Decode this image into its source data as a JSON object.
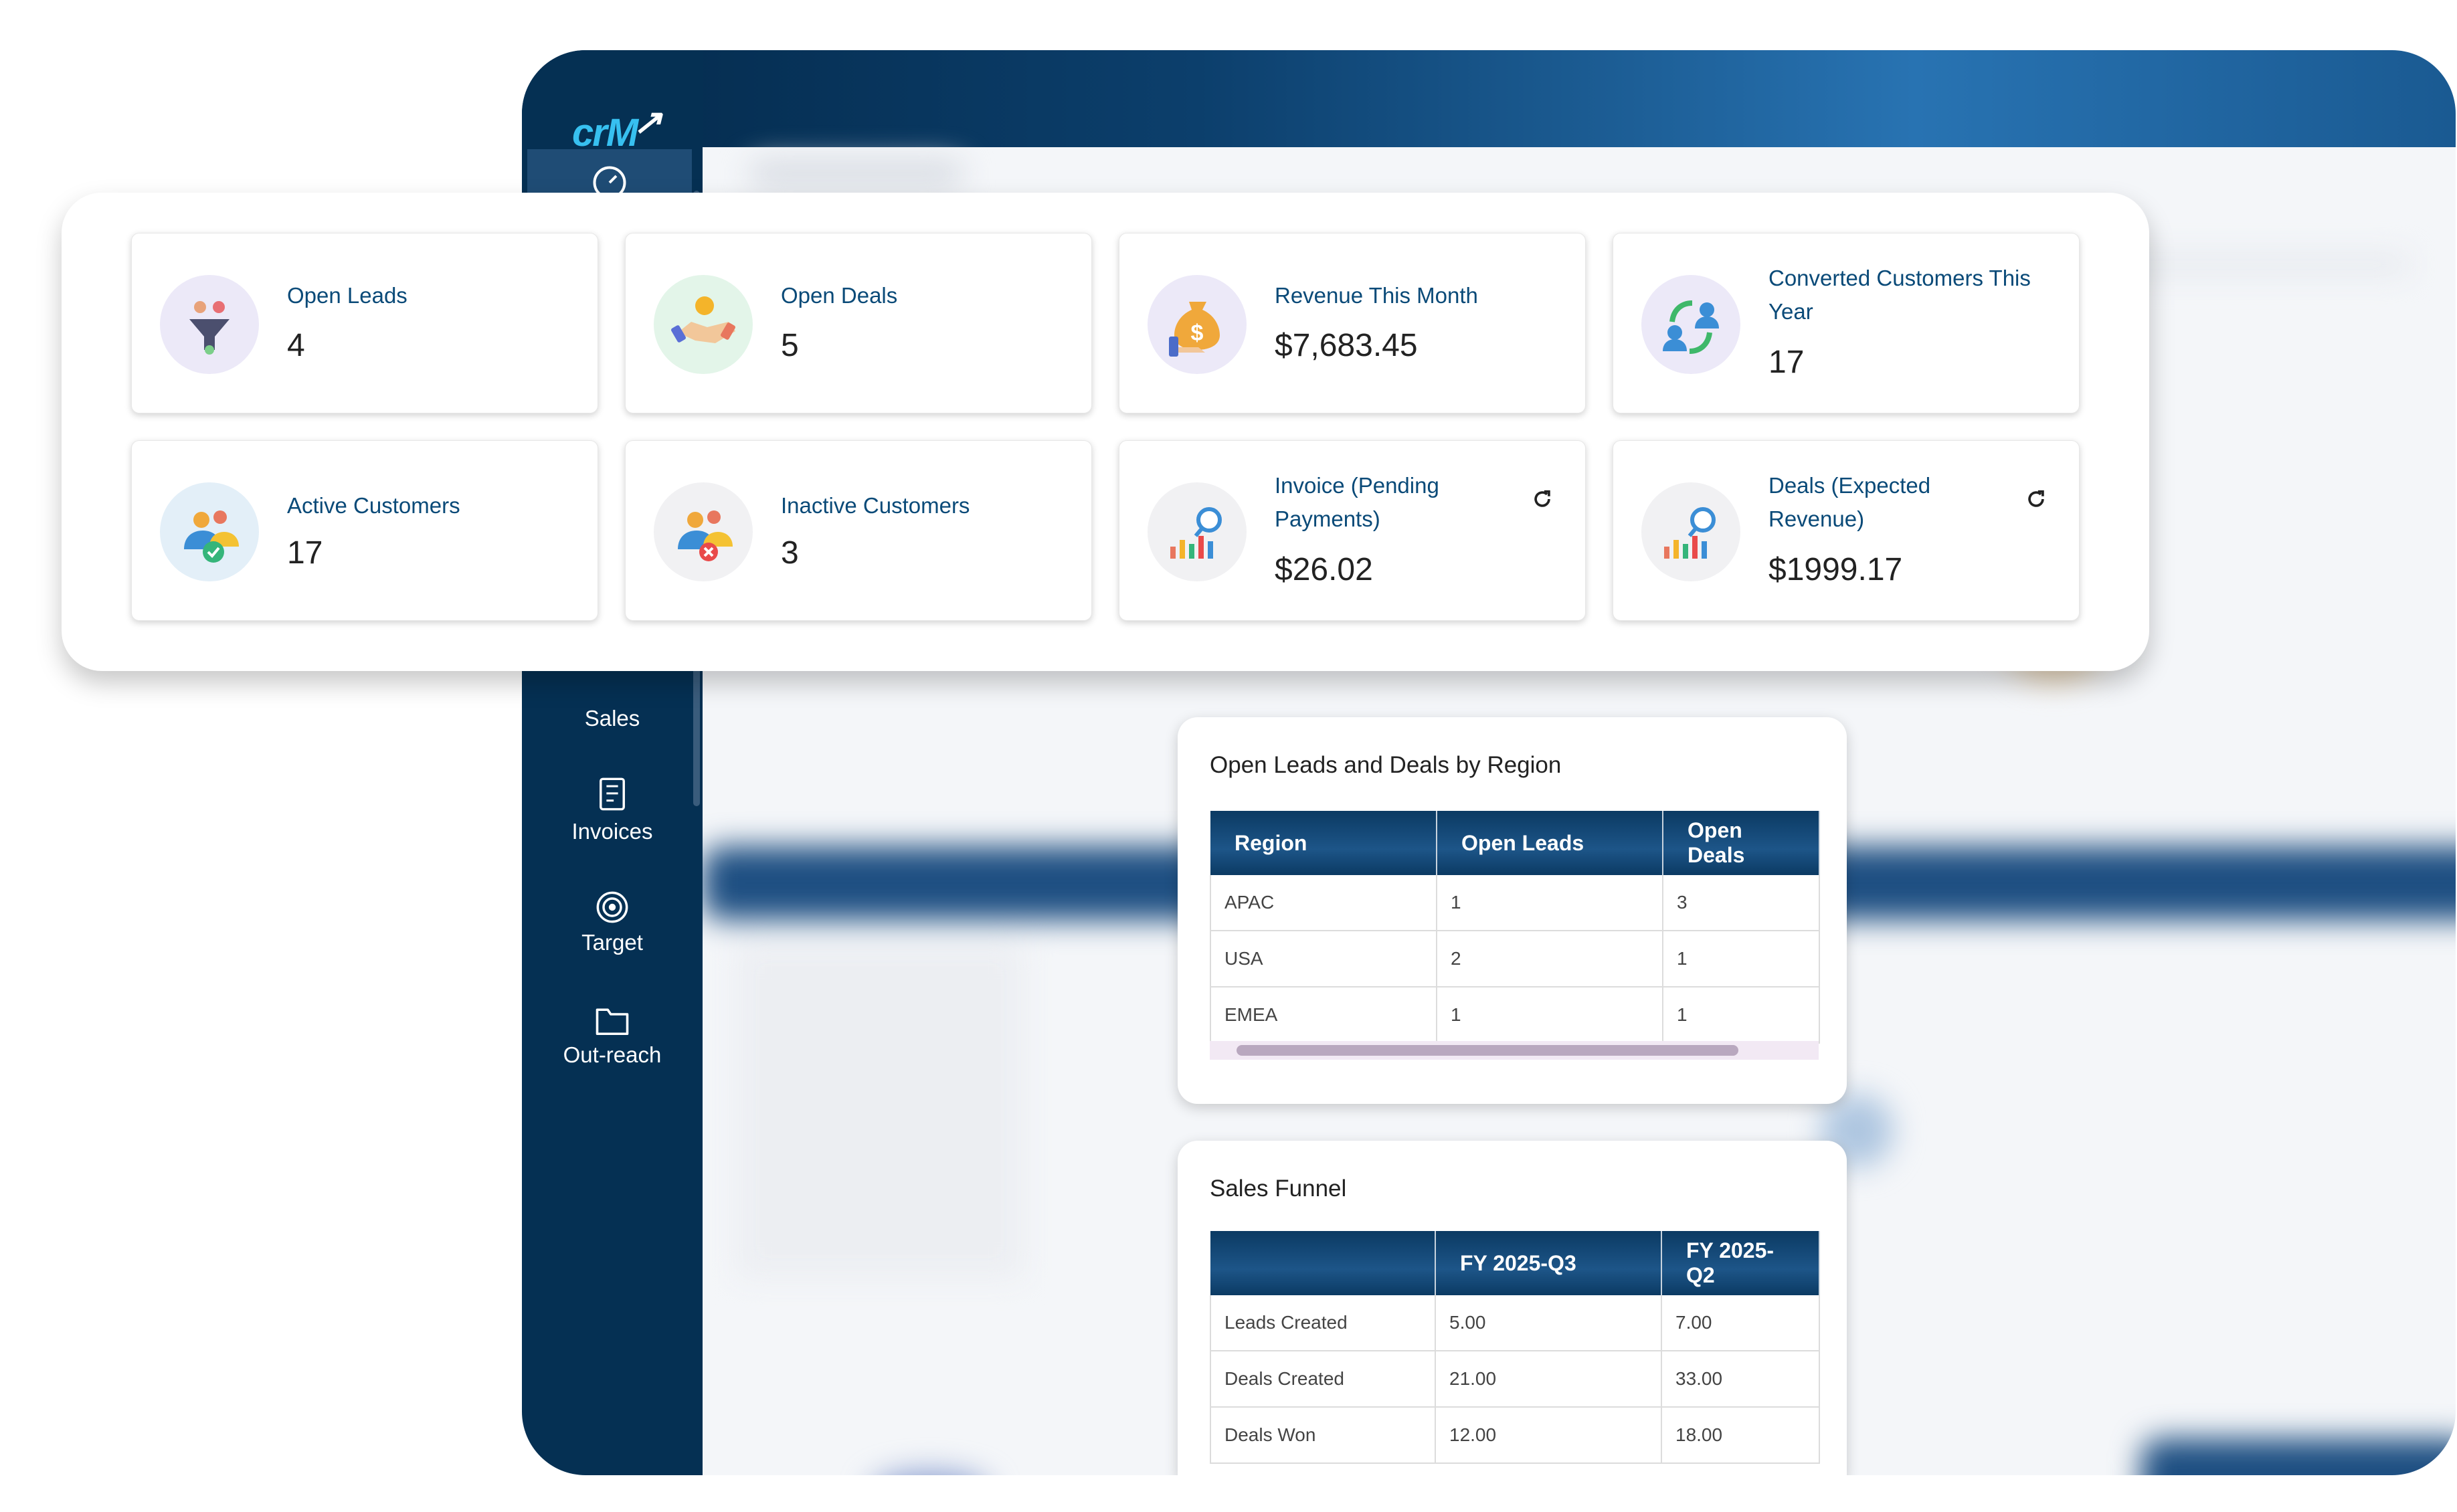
{
  "app": {
    "logo_text": "crM"
  },
  "sidebar": {
    "items": [
      {
        "label": "Sales",
        "icon": "sales-icon"
      },
      {
        "label": "Invoices",
        "icon": "invoice-icon"
      },
      {
        "label": "Target",
        "icon": "target-icon"
      },
      {
        "label": "Out-reach",
        "icon": "folder-icon"
      }
    ]
  },
  "kpis": [
    {
      "label": "Open Leads",
      "value": "4",
      "icon": "funnel-people-icon"
    },
    {
      "label": "Open Deals",
      "value": "5",
      "icon": "handshake-coin-icon"
    },
    {
      "label": "Revenue This Month",
      "value": "$7,683.45",
      "icon": "money-bag-icon"
    },
    {
      "label": "Converted Customers This Year",
      "value": "17",
      "icon": "convert-users-icon"
    },
    {
      "label": "Active Customers",
      "value": "17",
      "icon": "active-users-icon"
    },
    {
      "label": "Inactive Customers",
      "value": "3",
      "icon": "inactive-users-icon"
    },
    {
      "label": "Invoice (Pending Payments)",
      "value": "$26.02",
      "icon": "chart-magnifier-icon"
    },
    {
      "label": "Deals (Expected Revenue)",
      "value": "$1999.17",
      "icon": "chart-magnifier-icon"
    }
  ],
  "region_table": {
    "title": "Open Leads and Deals by Region",
    "columns": [
      "Region",
      "Open Leads",
      "Open Deals"
    ],
    "rows": [
      [
        "APAC",
        "1",
        "3"
      ],
      [
        "USA",
        "2",
        "1"
      ],
      [
        "EMEA",
        "1",
        "1"
      ]
    ]
  },
  "funnel_table": {
    "title": "Sales Funnel",
    "columns": [
      "",
      "FY 2025-Q3",
      "FY 2025-Q2"
    ],
    "rows": [
      [
        "Leads Created",
        "5.00",
        "7.00"
      ],
      [
        "Deals Created",
        "21.00",
        "33.00"
      ],
      [
        "Deals Won",
        "12.00",
        "18.00"
      ]
    ]
  },
  "colors": {
    "sidebar": "#053053",
    "topbar_start": "#03294a",
    "topbar_mid": "#2873b2",
    "kpi_label": "#0a4a78",
    "table_header": "#0b3a63"
  }
}
